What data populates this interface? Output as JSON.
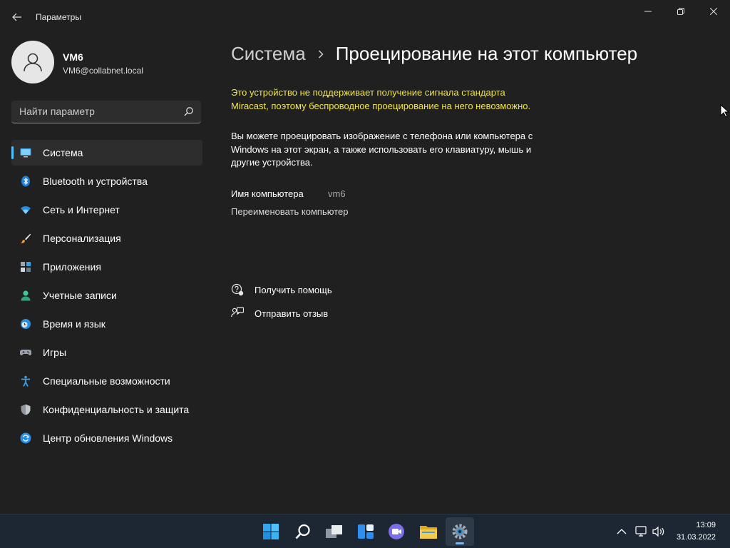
{
  "window": {
    "title": "Параметры",
    "controls": {
      "minimize": "minimize",
      "maximize": "restore",
      "close": "close"
    }
  },
  "profile": {
    "name": "VM6",
    "email": "VM6@collabnet.local"
  },
  "search": {
    "placeholder": "Найти параметр",
    "value": ""
  },
  "sidebar": {
    "items": [
      {
        "label": "Система",
        "icon": "system-icon",
        "selected": true
      },
      {
        "label": "Bluetooth и устройства",
        "icon": "bluetooth-icon"
      },
      {
        "label": "Сеть и Интернет",
        "icon": "wifi-icon"
      },
      {
        "label": "Персонализация",
        "icon": "brush-icon"
      },
      {
        "label": "Приложения",
        "icon": "apps-icon"
      },
      {
        "label": "Учетные записи",
        "icon": "accounts-icon"
      },
      {
        "label": "Время и язык",
        "icon": "time-language-icon"
      },
      {
        "label": "Игры",
        "icon": "gamepad-icon"
      },
      {
        "label": "Специальные возможности",
        "icon": "accessibility-icon"
      },
      {
        "label": "Конфиденциальность и защита",
        "icon": "shield-icon"
      },
      {
        "label": "Центр обновления Windows",
        "icon": "update-icon"
      }
    ]
  },
  "content": {
    "breadcrumb_parent": "Система",
    "breadcrumb_current": "Проецирование на этот компьютер",
    "warning": "Это устройство не поддерживает получение сигнала стандарта Miracast, поэтому беспроводное проецирование на него невозможно.",
    "description": "Вы можете проецировать изображение с телефона или компьютера с Windows на этот экран, а также использовать его клавиатуру, мышь и другие устройства.",
    "pc_name_label": "Имя компьютера",
    "pc_name_value": "vm6",
    "rename_link": "Переименовать компьютер",
    "help": "Получить помощь",
    "feedback": "Отправить отзыв"
  },
  "taskbar": {
    "apps": [
      "start-icon",
      "search-icon",
      "task-view-icon",
      "widgets-icon",
      "chat-icon",
      "file-explorer-icon",
      "settings-icon"
    ],
    "active_app": "settings-icon",
    "time": "13:09",
    "date": "31.03.2022"
  },
  "colors": {
    "accent": "#4cc2ff",
    "warning": "#f2e543",
    "background": "#202020",
    "taskbar": "#1c2733"
  }
}
